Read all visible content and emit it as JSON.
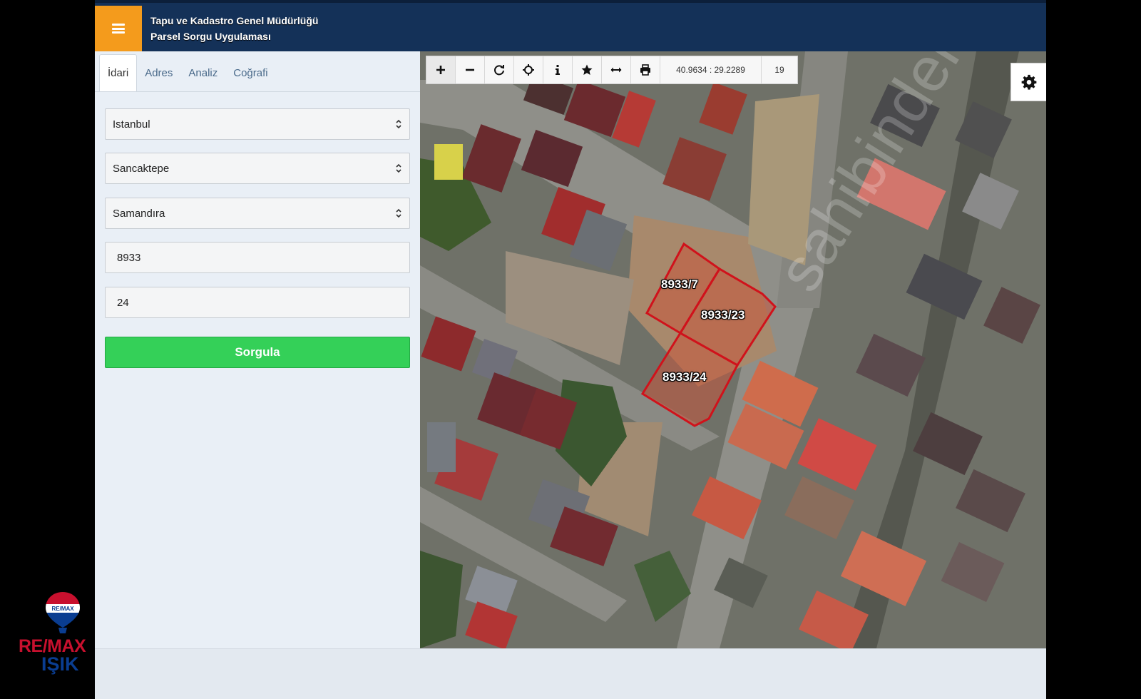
{
  "header": {
    "title_line1": "Tapu ve Kadastro Genel Müdürlüğü",
    "title_line2": "Parsel Sorgu Uygulaması"
  },
  "tabs": [
    {
      "label": "İdari",
      "active": true
    },
    {
      "label": "Adres",
      "active": false
    },
    {
      "label": "Analiz",
      "active": false
    },
    {
      "label": "Coğrafi",
      "active": false
    }
  ],
  "form": {
    "il": "Istanbul",
    "ilce": "Sancaktepe",
    "mahalle": "Samandıra",
    "ada": "8933",
    "parsel": "24",
    "submit_label": "Sorgula"
  },
  "map": {
    "coords": "40.9634 : 29.2289",
    "zoom": "19",
    "toolbar_icons": [
      "zoom-in-icon",
      "zoom-out-icon",
      "refresh-icon",
      "locate-icon",
      "info-icon",
      "star-icon",
      "measure-icon",
      "print-icon"
    ],
    "parcels": [
      {
        "label": "8933/7"
      },
      {
        "label": "8933/23"
      },
      {
        "label": "8933/24"
      }
    ],
    "watermark": "sahibinden.com"
  },
  "logo": {
    "brand": "RE/MAX",
    "balloon_text": "RE/MAX",
    "office": "IŞIK"
  },
  "colors": {
    "header_bg": "#143158",
    "menu_button": "#f49b1c",
    "submit_button": "#34d058",
    "parcel_outline": "#d0121b"
  }
}
